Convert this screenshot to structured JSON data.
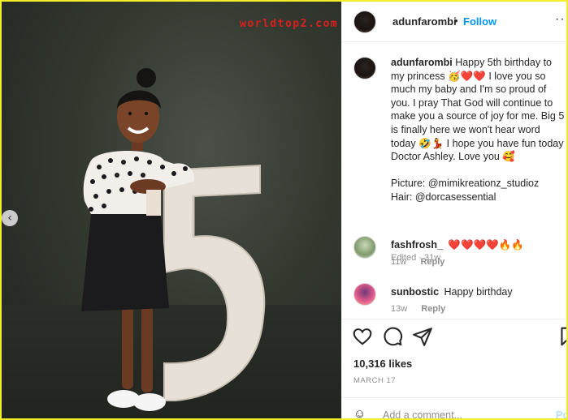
{
  "photo": {
    "watermark": "worldtop2.com",
    "prev_icon": "chevron-left-icon",
    "prev_glyph": "‹"
  },
  "header": {
    "username": "adunfarombi",
    "dot": "•",
    "follow_label": "Follow",
    "more_glyph": "···"
  },
  "caption": {
    "username": "adunfarombi",
    "lines": [
      "Happy 5th birthday to my princess 🥳❤️❤️ I love you so much my baby and I'm so proud of you. I pray That God will continue to make you a source of joy for me. Big 5 is finally here we won't hear word today 🤣💃 I hope you have fun today Doctor Ashley. Love you 🥰",
      "Picture: @mimikreationz_studioz",
      "Hair: @dorcasessential"
    ],
    "meta": "Edited · 31w"
  },
  "comments": [
    {
      "username": "fashfrosh_",
      "text": "❤️❤️❤️❤️🔥🔥",
      "time": "11w",
      "reply": "Reply"
    },
    {
      "username": "sunbostic",
      "text": "Happy birthday",
      "time": "13w",
      "reply": "Reply"
    }
  ],
  "actions": {
    "like_icon": "heart-icon",
    "comment_icon": "comment-icon",
    "share_icon": "share-icon",
    "save_icon": "bookmark-icon"
  },
  "likes": "10,316 likes",
  "date": "MARCH 17",
  "add_comment": {
    "emoji_glyph": "☺",
    "placeholder": "Add a comment...",
    "post_label": "Post"
  },
  "colors": {
    "accent": "#0095f6",
    "text": "#262626",
    "muted": "#8e8e8e",
    "watermark": "#d8201e",
    "frame": "#f2ef2a"
  }
}
